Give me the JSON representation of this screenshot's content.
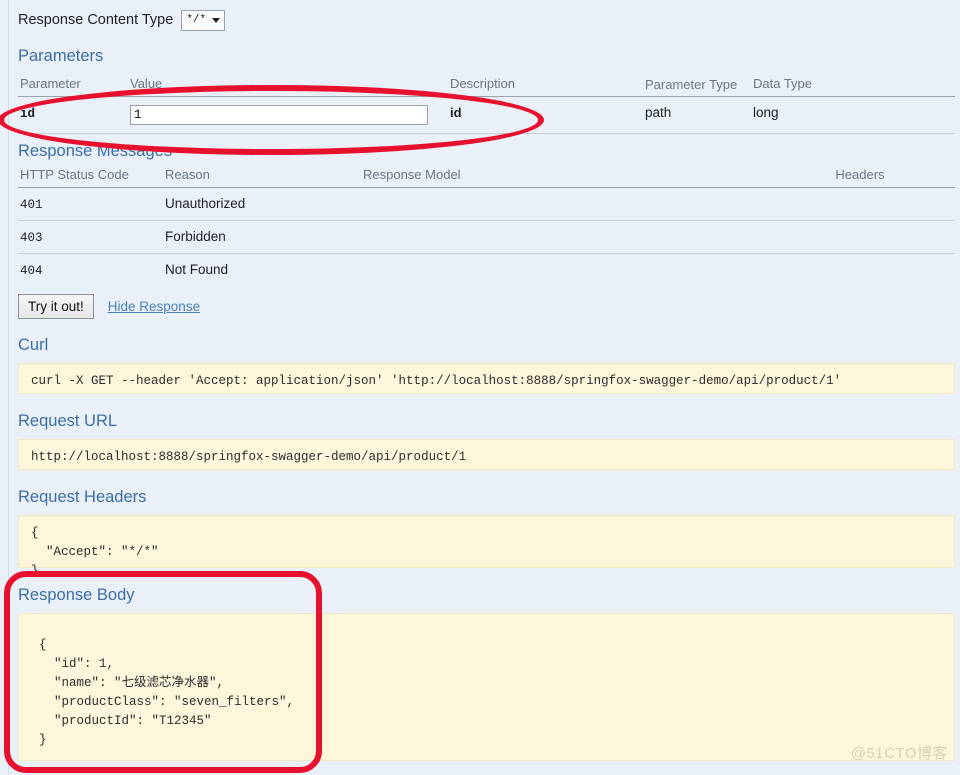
{
  "response_content_type": {
    "label": "Response Content Type",
    "selected": "*/*",
    "options": [
      "*/*"
    ],
    "caret_icon": "chevron-down-icon"
  },
  "parameters": {
    "heading": "Parameters",
    "columns": [
      "Parameter",
      "Value",
      "Description",
      "Parameter Type",
      "Data Type"
    ],
    "rows": [
      {
        "parameter": "id",
        "value": "1",
        "value_placeholder": "",
        "description": "id",
        "parameter_type": "path",
        "data_type": "long"
      }
    ]
  },
  "response_messages": {
    "heading": "Response Messages",
    "columns": [
      "HTTP Status Code",
      "Reason",
      "Response Model",
      "Headers"
    ],
    "rows": [
      {
        "code": "401",
        "reason": "Unauthorized",
        "model": "",
        "headers": ""
      },
      {
        "code": "403",
        "reason": "Forbidden",
        "model": "",
        "headers": ""
      },
      {
        "code": "404",
        "reason": "Not Found",
        "model": "",
        "headers": ""
      }
    ]
  },
  "actions": {
    "try_label": "Try it out!",
    "hide_response_label": "Hide Response"
  },
  "curl": {
    "heading": "Curl",
    "command": "curl -X GET --header 'Accept: application/json' 'http://localhost:8888/springfox-swagger-demo/api/product/1'"
  },
  "request_url": {
    "heading": "Request URL",
    "url": "http://localhost:8888/springfox-swagger-demo/api/product/1"
  },
  "request_headers": {
    "heading": "Request Headers",
    "body": "{\n  \"Accept\": \"*/*\"\n}"
  },
  "response_body": {
    "heading": "Response Body",
    "body": "{\n  \"id\": 1,\n  \"name\": \"七级滤芯净水器\",\n  \"productClass\": \"seven_filters\",\n  \"productId\": \"T12345\"\n}"
  },
  "annotations": {
    "color": "#e8112d",
    "shapes": [
      "parameters-row-oval",
      "response-body-rect"
    ]
  },
  "watermark": {
    "text": "@51CTO博客"
  }
}
